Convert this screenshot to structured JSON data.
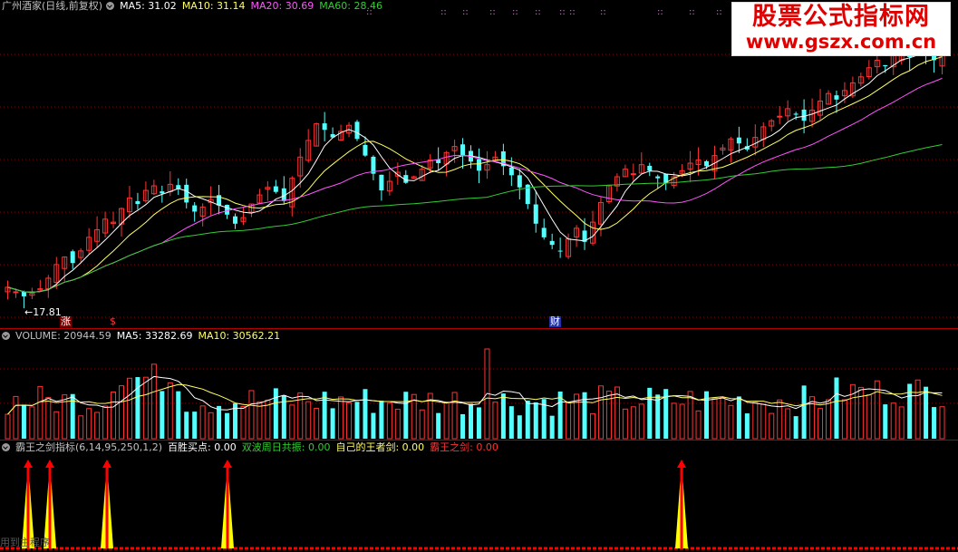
{
  "colors": {
    "up": "#ff3333",
    "down": "#54ffff",
    "ma5": "#ffffff",
    "ma10": "#ffff66",
    "ma20": "#ff55ff",
    "ma60": "#33cc33",
    "grid": "#8a0000",
    "signal": "#ff0000",
    "signal_fill": "#ffff00"
  },
  "main": {
    "title": "广州酒家(日线,前复权)",
    "ma5": "MA5: 31.02",
    "ma10": "MA10: 31.14",
    "ma20": "MA20: 30.69",
    "ma60": "MA60: 28.46",
    "low_label": "←17.81",
    "markers": [
      "涨",
      "$",
      "财"
    ]
  },
  "volume": {
    "label": "VOLUME: 20944.59",
    "ma5": "MA5: 33282.69",
    "ma10": "MA10: 30562.21"
  },
  "indicator": {
    "name": "霸王之剑指标(6,14,95,250,1,2)",
    "b1": "百胜买点: 0.00",
    "b2": "双波周日共振: 0.00",
    "b3": "自己的王者剑: 0.00",
    "b4": "霸王之剑: 0.00",
    "bottom_text": "用到主程序"
  },
  "watermark": {
    "line1": "股票公式指标网",
    "line2": "www.gszx.com.cn"
  },
  "chart_data": {
    "type": "candlestick",
    "series_closes": [
      18.6,
      18.3,
      18.0,
      18.2,
      18.5,
      19.2,
      20.1,
      20.6,
      20.2,
      21.0,
      21.9,
      22.4,
      23.1,
      22.9,
      23.8,
      24.5,
      24.1,
      25.0,
      25.3,
      24.8,
      25.4,
      25.1,
      24.2,
      23.6,
      23.9,
      24.4,
      24.0,
      23.4,
      22.8,
      23.2,
      24.1,
      24.7,
      25.2,
      24.9,
      24.3,
      25.8,
      27.2,
      28.3,
      29.4,
      29.0,
      28.5,
      28.9,
      29.3,
      28.4,
      27.3,
      26.1,
      25.0,
      25.6,
      26.2,
      25.5,
      25.9,
      26.4,
      27.0,
      26.8,
      27.5,
      27.9,
      27.3,
      26.9,
      26.3,
      26.7,
      27.2,
      26.6,
      26.0,
      25.2,
      24.1,
      22.8,
      21.9,
      21.4,
      21.0,
      21.8,
      22.5,
      21.6,
      22.9,
      24.2,
      25.3,
      25.9,
      26.4,
      26.1,
      26.7,
      26.3,
      25.8,
      25.5,
      25.9,
      26.3,
      26.8,
      27.0,
      26.6,
      27.3,
      27.8,
      28.4,
      28.1,
      27.7,
      28.5,
      29.2,
      29.6,
      29.9,
      30.4,
      30.0,
      29.6,
      30.3,
      30.9,
      31.4,
      31.0,
      31.6,
      32.1,
      32.5,
      33.1,
      33.6,
      33.2,
      33.9,
      34.3,
      33.8,
      34.5,
      34.1,
      33.6,
      34.2
    ],
    "volume_last": 20944.59,
    "indicator_peaks_count": 5
  }
}
